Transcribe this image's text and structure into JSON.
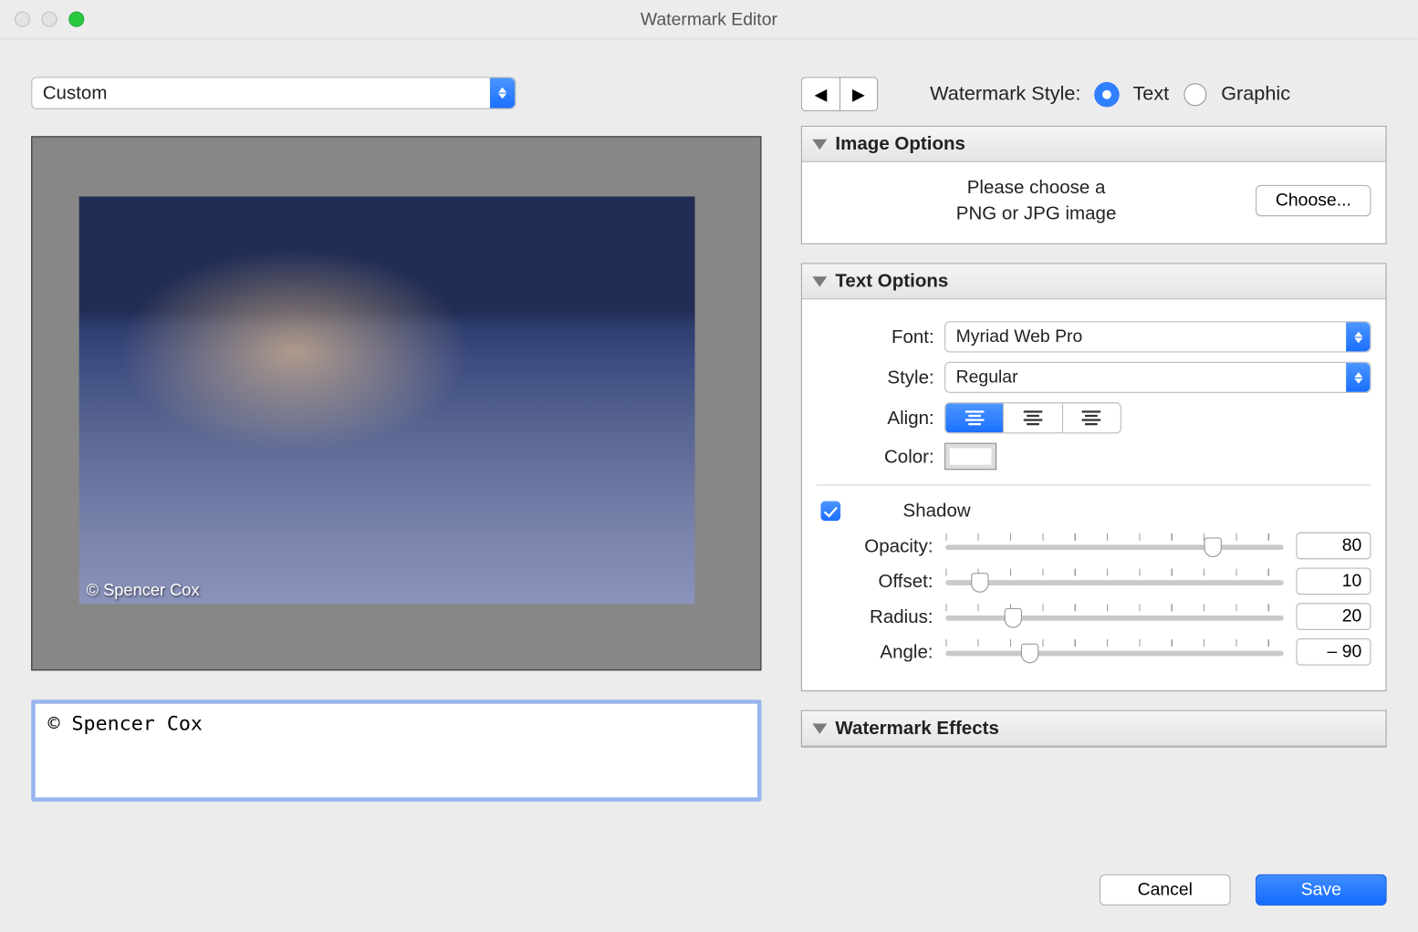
{
  "window": {
    "title": "Watermark Editor"
  },
  "preset": {
    "value": "Custom"
  },
  "style": {
    "label": "Watermark Style:",
    "text": "Text",
    "graphic": "Graphic"
  },
  "watermark_text": "© Spencer Cox",
  "preview_text": "© Spencer Cox",
  "image_options": {
    "title": "Image Options",
    "line1": "Please choose a",
    "line2": "PNG or JPG image",
    "choose": "Choose..."
  },
  "text_options": {
    "title": "Text Options",
    "font_label": "Font:",
    "font_value": "Myriad Web Pro",
    "style_label": "Style:",
    "style_value": "Regular",
    "align_label": "Align:",
    "color_label": "Color:",
    "shadow_label": "Shadow",
    "opacity_label": "Opacity:",
    "offset_label": "Offset:",
    "radius_label": "Radius:",
    "angle_label": "Angle:",
    "opacity_value": "80",
    "offset_value": "10",
    "radius_value": "20",
    "angle_value": "– 90"
  },
  "effects": {
    "title": "Watermark Effects"
  },
  "buttons": {
    "cancel": "Cancel",
    "save": "Save"
  },
  "sliders": {
    "opacity_pct": 79,
    "offset_pct": 10,
    "radius_pct": 20,
    "angle_pct": 25
  }
}
